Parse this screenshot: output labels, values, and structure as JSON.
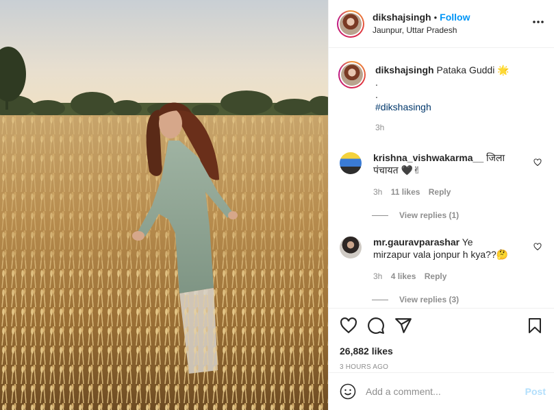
{
  "post": {
    "username": "dikshajsingh",
    "follow_label": "Follow",
    "location": "Jaunpur, Uttar Pradesh",
    "separator": "•",
    "more_icon": "more-horizontal-icon",
    "image_description_icon": "photo"
  },
  "caption": {
    "username": "dikshajsingh",
    "text": "Pataka Guddi",
    "emoji": "🌟",
    "line2": ".",
    "line3": ".",
    "hashtag": "#dikshasingh",
    "time": "3h"
  },
  "comments": [
    {
      "username": "krishna_vishwakarma__",
      "text": "जिला पंचायत 🖤✌",
      "time": "3h",
      "likes": "11 likes",
      "reply_label": "Reply",
      "view_replies": "View replies (1)"
    },
    {
      "username": "mr.gauravparashar",
      "text": "Ye mirzapur vala jonpur h kya??🤔",
      "time": "3h",
      "likes": "4 likes",
      "reply_label": "Reply",
      "view_replies": "View replies (3)"
    }
  ],
  "actions": {
    "likes": "26,882 likes",
    "posted_ago": "3 HOURS AGO"
  },
  "add_comment": {
    "placeholder": "Add a comment...",
    "post_label": "Post"
  },
  "colors": {
    "link": "#0095f6",
    "muted": "#8e8e8e",
    "text": "#262626",
    "post_disabled": "#b2dffc"
  }
}
